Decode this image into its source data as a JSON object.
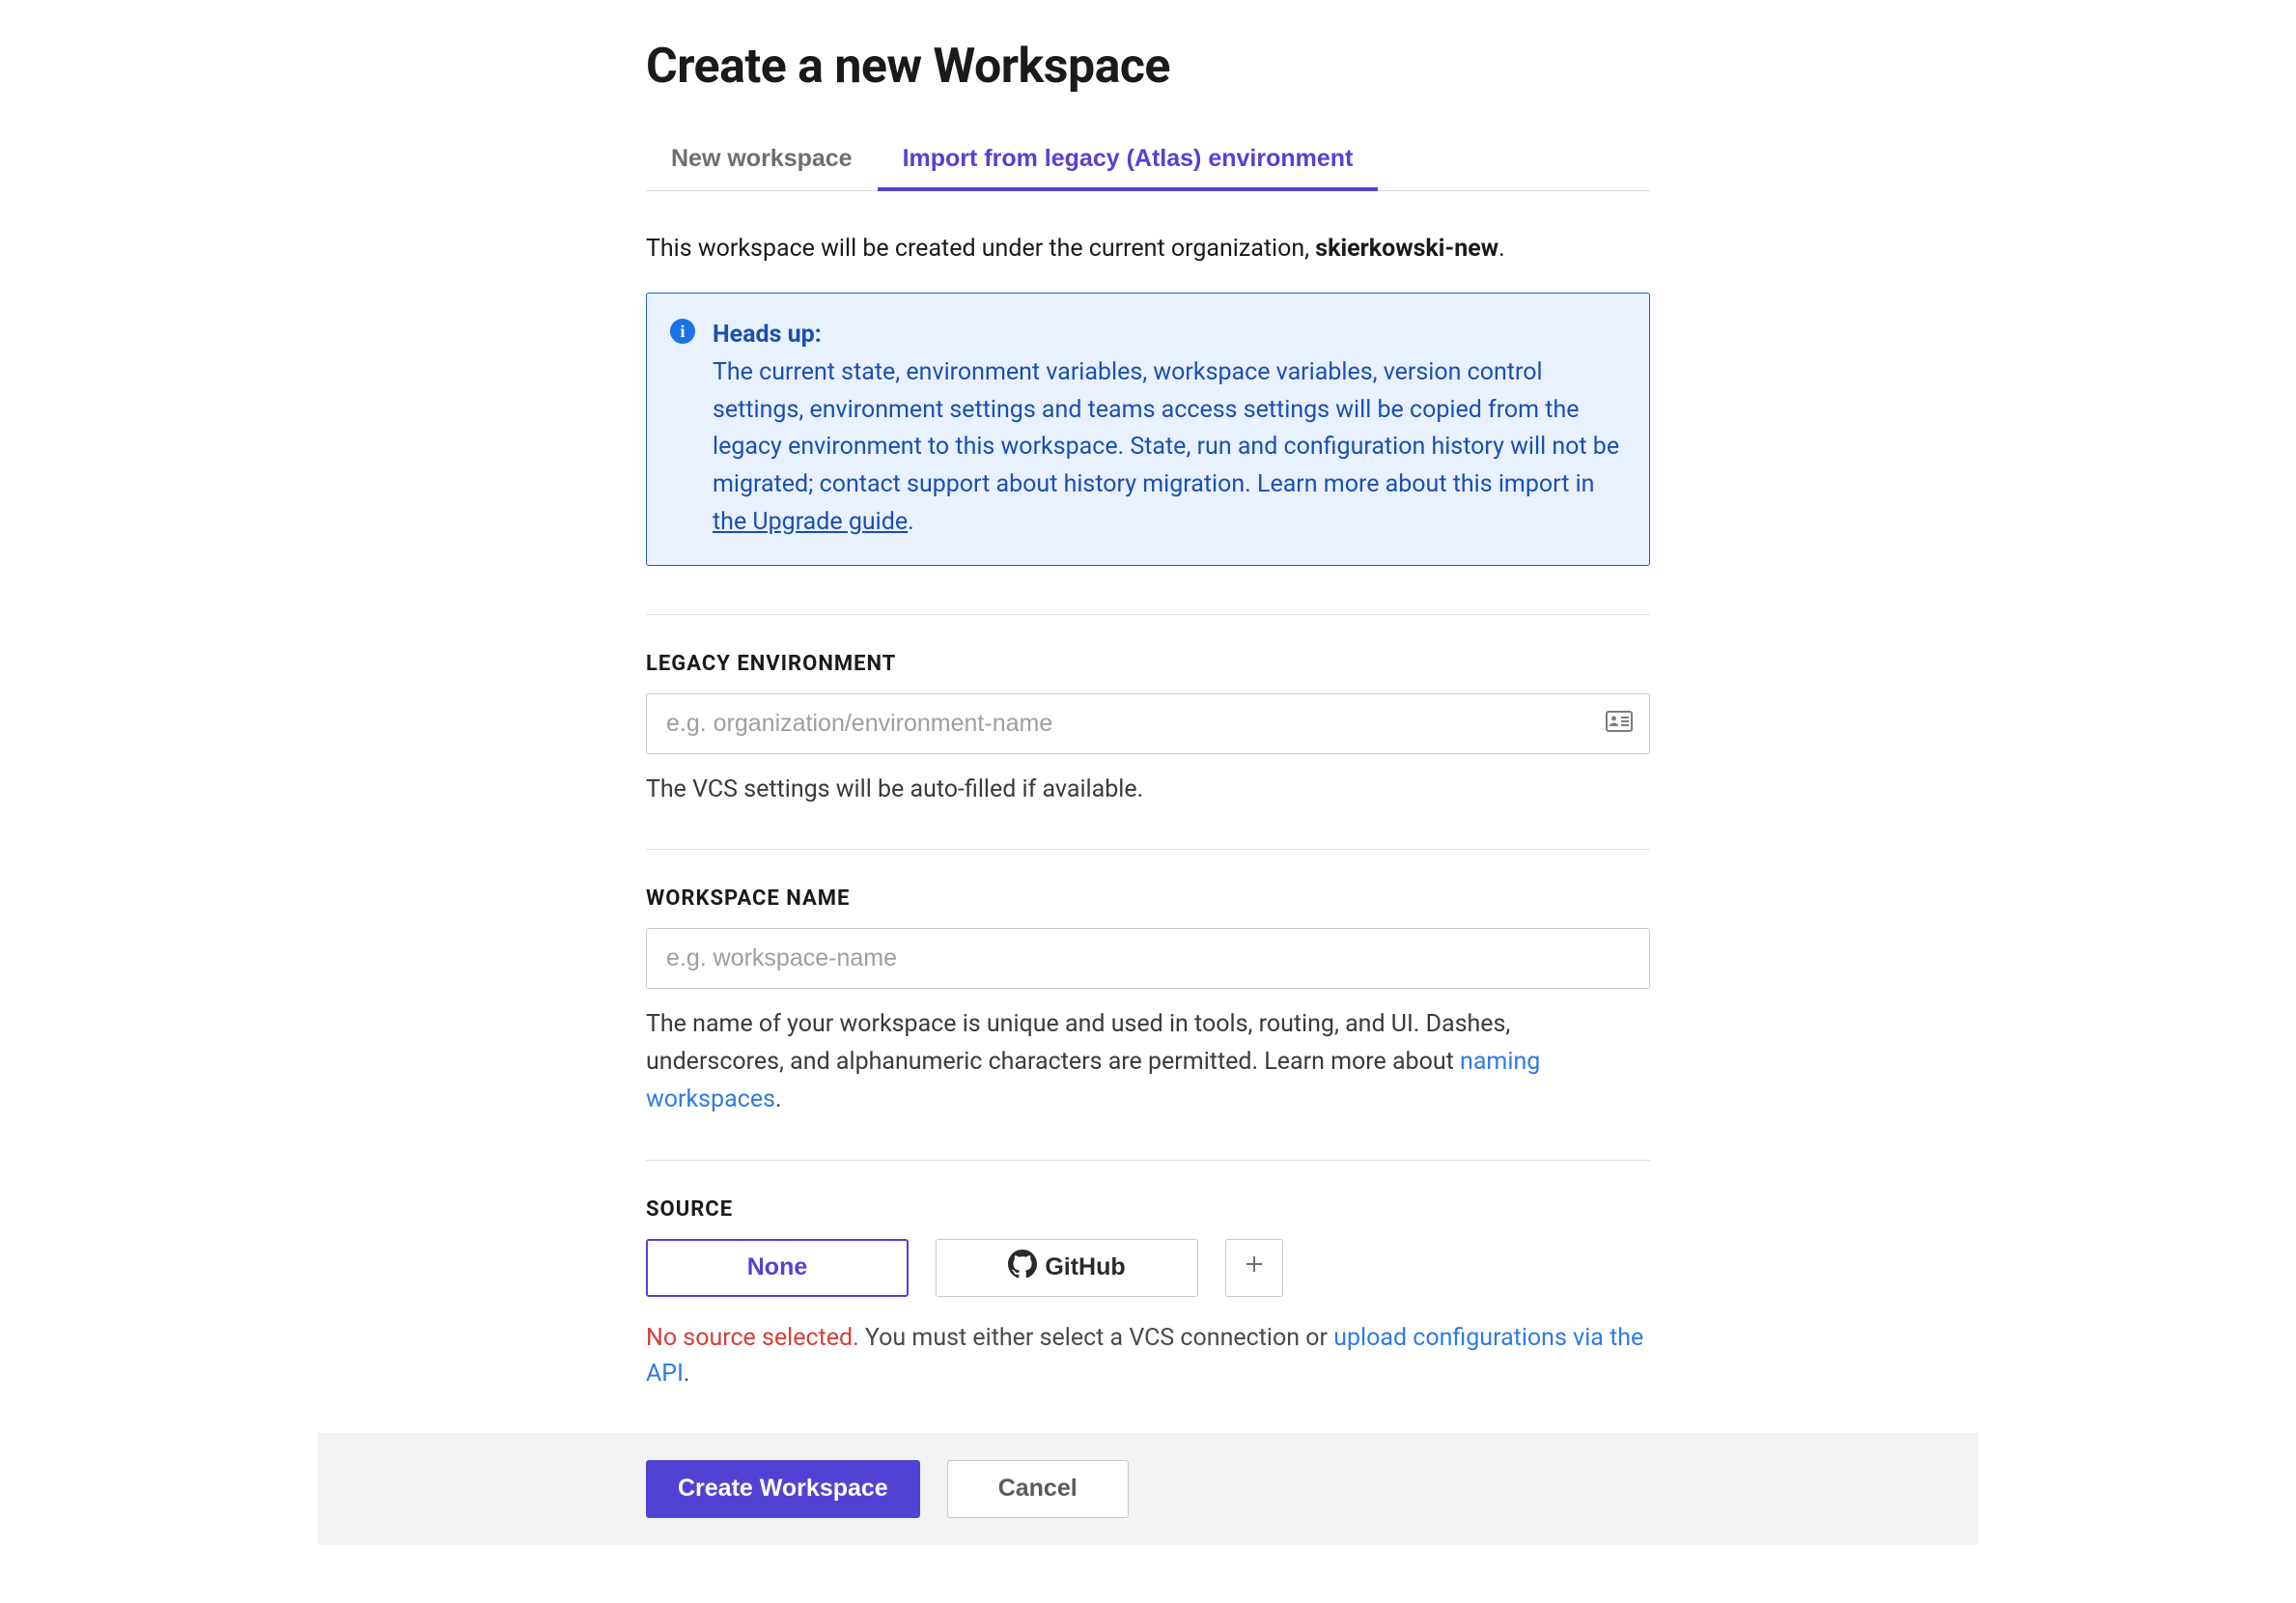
{
  "page_title": "Create a new Workspace",
  "tabs": {
    "new": "New workspace",
    "import": "Import from legacy (Atlas) environment"
  },
  "description": {
    "prefix": "This workspace will be created under the current organization, ",
    "org_name": "skierkowski-new",
    "suffix": "."
  },
  "alert": {
    "heading": "Heads up:",
    "body_1": "The current state, environment variables, workspace variables, version control settings, environment settings and teams access settings will be copied from the legacy environment to this workspace. State, run and configuration history will not be migrated; contact support about history migration. Learn more about this import in ",
    "link_text": "the Upgrade guide",
    "body_2": "."
  },
  "legacy_env": {
    "label": "LEGACY ENVIRONMENT",
    "placeholder": "e.g. organization/environment-name",
    "value": "",
    "help": "The VCS settings will be auto-filled if available."
  },
  "workspace_name": {
    "label": "WORKSPACE NAME",
    "placeholder": "e.g. workspace-name",
    "value": "",
    "help_prefix": "The name of your workspace is unique and used in tools, routing, and UI. Dashes, underscores, and alphanumeric characters are permitted. Learn more about ",
    "help_link": "naming workspaces",
    "help_suffix": "."
  },
  "source": {
    "label": "SOURCE",
    "options": {
      "none": "None",
      "github": "GitHub"
    },
    "error_prefix": "No source selected.",
    "help_middle": " You must either select a VCS connection or ",
    "help_link": "upload configurations via the API",
    "help_suffix": "."
  },
  "footer": {
    "submit": "Create Workspace",
    "cancel": "Cancel"
  }
}
